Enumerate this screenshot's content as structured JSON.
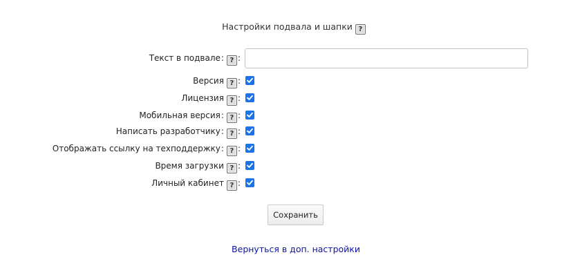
{
  "page": {
    "title": "Настройки подвала и шапки",
    "help_glyph": "?",
    "colon": ":"
  },
  "form": {
    "footer_text": {
      "label": "Текст в подвале",
      "value": "",
      "placeholder": ""
    },
    "options": [
      {
        "label": "Версия",
        "checked": true
      },
      {
        "label": "Лицензия",
        "checked": true
      },
      {
        "label": "Мобильная версия",
        "checked": true
      },
      {
        "label": "Написать разработчику",
        "checked": true
      },
      {
        "label": "Отображать ссылку на техподдержку",
        "checked": true
      },
      {
        "label": "Время загрузки",
        "checked": true
      },
      {
        "label": "Личный кабинет",
        "checked": true
      }
    ],
    "save_label": "Сохранить"
  },
  "footer": {
    "back_link": "Вернуться в доп. настройки"
  },
  "colors": {
    "checkbox": "#1a73e8",
    "link": "#0b12a8"
  },
  "icons": {
    "help": "help-icon",
    "check": "checkmark-icon"
  }
}
